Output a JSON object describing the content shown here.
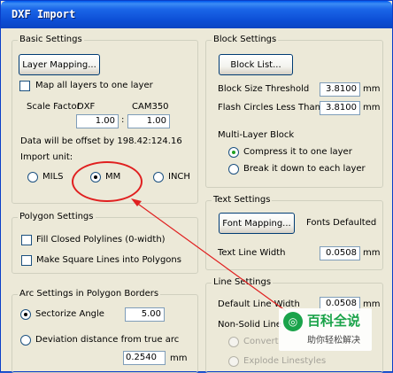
{
  "window": {
    "title": "DXF Import"
  },
  "basic": {
    "legend": "Basic Settings",
    "layer_mapping_button": "Layer Mapping...",
    "map_all_layers_label": "Map all layers to one layer",
    "scale_factor_label": "Scale Factor",
    "dxf_label": "DXF",
    "cam_label": "CAM350",
    "dxf_value": "1.00",
    "cam_value": "1.00",
    "offset_text": "Data will be offset by 198.42:124.16",
    "import_unit_label": "Import unit:",
    "unit_options": [
      "MILS",
      "MM",
      "INCH"
    ],
    "unit_selected": "MM"
  },
  "polygon": {
    "legend": "Polygon Settings",
    "fill_closed_label": "Fill Closed Polylines (0-width)",
    "make_square_label": "Make Square Lines into Polygons"
  },
  "arc": {
    "legend": "Arc Settings in Polygon Borders",
    "sectorize_label": "Sectorize Angle",
    "sectorize_value": "5.00",
    "deviation_label": "Deviation distance from true arc",
    "deviation_value": "0.2540",
    "deviation_unit": "mm"
  },
  "block": {
    "legend": "Block Settings",
    "block_list_button": "Block List...",
    "threshold_label": "Block Size Threshold",
    "threshold_value": "3.8100",
    "threshold_unit": "mm",
    "flash_label": "Flash Circles Less Than",
    "flash_value": "3.8100",
    "flash_unit": "mm",
    "multilayer_label": "Multi-Layer Block",
    "compress_label": "Compress it to one layer",
    "break_label": "Break it down to each layer"
  },
  "text": {
    "legend": "Text Settings",
    "font_mapping_button": "Font Mapping...",
    "fonts_status": "Fonts Defaulted",
    "line_width_label": "Text Line Width",
    "line_width_value": "0.0508",
    "line_width_unit": "mm"
  },
  "line": {
    "legend": "Line Settings",
    "default_width_label": "Default Line Width",
    "default_width_value": "0.0508",
    "default_width_unit": "mm",
    "non_solid_label": "Non-Solid Line",
    "convert_label": "Convert",
    "explode_label": "Explode Linestyles"
  },
  "watermark": {
    "title": "百科全说",
    "subtitle": "助你轻松解决"
  },
  "annotation_color": "#e02020"
}
